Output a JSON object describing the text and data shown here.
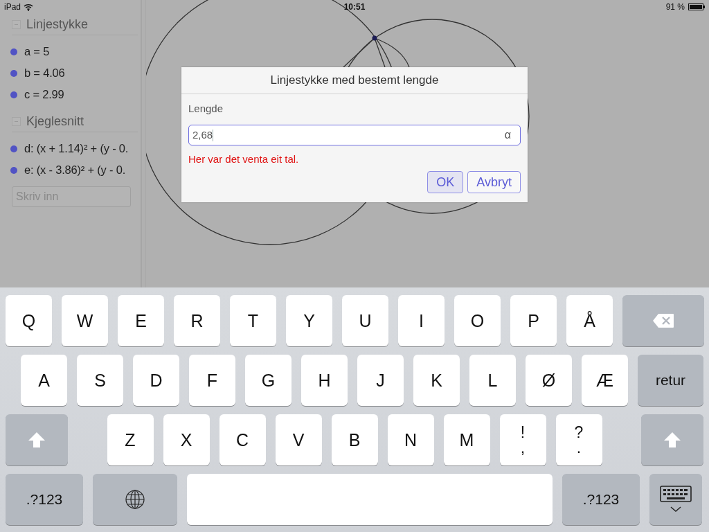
{
  "status_bar": {
    "device": "iPad",
    "time": "10:51",
    "battery": "91 %"
  },
  "sidebar": {
    "sections": [
      {
        "title": "Linjestykke",
        "expanded": true,
        "items": [
          "a = 5",
          "b = 4.06",
          "c = 2.99"
        ]
      },
      {
        "title": "Kjeglesnitt",
        "expanded": true,
        "items": [
          "d: (x + 1.14)² + (y - 0.",
          "e: (x - 3.86)² + (y - 0."
        ]
      }
    ],
    "input": {
      "placeholder": "Skriv inn"
    }
  },
  "dialog": {
    "title": "Linjestykke med bestemt lengde",
    "label": "Lengde",
    "value": "2,68",
    "symbol_button": "α",
    "error": "Her var det venta eit tal.",
    "buttons": [
      {
        "label": "OK",
        "highlighted": true
      },
      {
        "label": "Avbryt",
        "highlighted": false
      }
    ]
  },
  "keyboard": {
    "rows": [
      {
        "keys": [
          {
            "kind": "letter",
            "label": "Q"
          },
          {
            "kind": "letter",
            "label": "W"
          },
          {
            "kind": "letter",
            "label": "E"
          },
          {
            "kind": "letter",
            "label": "R"
          },
          {
            "kind": "letter",
            "label": "T"
          },
          {
            "kind": "letter",
            "label": "Y"
          },
          {
            "kind": "letter",
            "label": "U"
          },
          {
            "kind": "letter",
            "label": "I"
          },
          {
            "kind": "letter",
            "label": "O"
          },
          {
            "kind": "letter",
            "label": "P"
          },
          {
            "kind": "letter",
            "label": "Å"
          },
          {
            "kind": "backspace"
          }
        ]
      },
      {
        "keys": [
          {
            "kind": "letter",
            "label": "A"
          },
          {
            "kind": "letter",
            "label": "S"
          },
          {
            "kind": "letter",
            "label": "D"
          },
          {
            "kind": "letter",
            "label": "F"
          },
          {
            "kind": "letter",
            "label": "G"
          },
          {
            "kind": "letter",
            "label": "H"
          },
          {
            "kind": "letter",
            "label": "J"
          },
          {
            "kind": "letter",
            "label": "K"
          },
          {
            "kind": "letter",
            "label": "L"
          },
          {
            "kind": "letter",
            "label": "Ø"
          },
          {
            "kind": "letter",
            "label": "Æ"
          },
          {
            "kind": "return",
            "label": "retur"
          }
        ]
      },
      {
        "keys": [
          {
            "kind": "shift"
          },
          {
            "kind": "letter",
            "label": "Z"
          },
          {
            "kind": "letter",
            "label": "X"
          },
          {
            "kind": "letter",
            "label": "C"
          },
          {
            "kind": "letter",
            "label": "V"
          },
          {
            "kind": "letter",
            "label": "B"
          },
          {
            "kind": "letter",
            "label": "N"
          },
          {
            "kind": "letter",
            "label": "M"
          },
          {
            "kind": "dual",
            "label": "!",
            "sublabel": ","
          },
          {
            "kind": "dual",
            "label": "?",
            "sublabel": "."
          },
          {
            "kind": "shift"
          }
        ]
      },
      {
        "keys": [
          {
            "kind": "mode",
            "label": ".?123"
          },
          {
            "kind": "globe"
          },
          {
            "kind": "space"
          },
          {
            "kind": "mode",
            "label": ".?123"
          },
          {
            "kind": "hide"
          }
        ]
      }
    ]
  }
}
